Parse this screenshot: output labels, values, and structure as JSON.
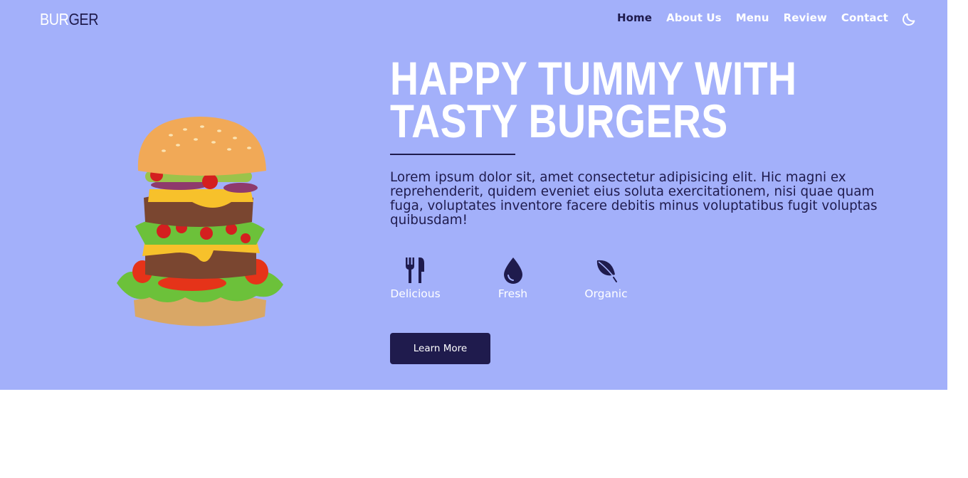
{
  "header": {
    "logo_part1": "BUR",
    "logo_part2": "GER",
    "nav": [
      "Home",
      "About Us",
      "Menu",
      "Review",
      "Contact"
    ],
    "active_nav": "Home",
    "theme_toggle_icon": "moon-icon"
  },
  "hero": {
    "title": "HAPPY TUMMY WITH TASTY BURGERS",
    "description": "Lorem ipsum dolor sit, amet consectetur adipisicing elit. Hic magni ex reprehenderit, quidem eveniet eius soluta exercitationem, nisi quae quam fuga, voluptates inventore facere debitis minus voluptatibus fugit voluptas quibusdam!",
    "features": [
      {
        "icon": "utensils-icon",
        "label": "Delicious"
      },
      {
        "icon": "water-drop-icon",
        "label": "Fresh"
      },
      {
        "icon": "leaf-icon",
        "label": "Organic"
      }
    ],
    "button_label": "Learn More",
    "image": "burger-image"
  },
  "colors": {
    "hero_background": "#a3b0fa",
    "accent_dark": "#1f1b4d",
    "text_light": "#ffffff",
    "page_background": "#ffffff"
  }
}
